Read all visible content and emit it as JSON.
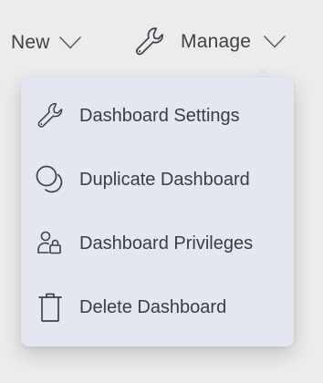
{
  "toolbar": {
    "new_label": "New",
    "new_chevron_icon": "chevron-down-icon",
    "manage_icon": "wrench-icon",
    "manage_label": "Manage",
    "manage_chevron_icon": "chevron-down-icon"
  },
  "manage_menu": {
    "items": [
      {
        "label": "Dashboard Settings",
        "icon": "wrench-icon"
      },
      {
        "label": "Duplicate Dashboard",
        "icon": "duplicate-icon"
      },
      {
        "label": "Dashboard Privileges",
        "icon": "user-lock-icon"
      },
      {
        "label": "Delete Dashboard",
        "icon": "trash-icon"
      }
    ]
  },
  "colors": {
    "background": "#ececec",
    "menu_background": "#e4e6f1",
    "text": "#3a3d45",
    "icon": "#3e4149"
  }
}
